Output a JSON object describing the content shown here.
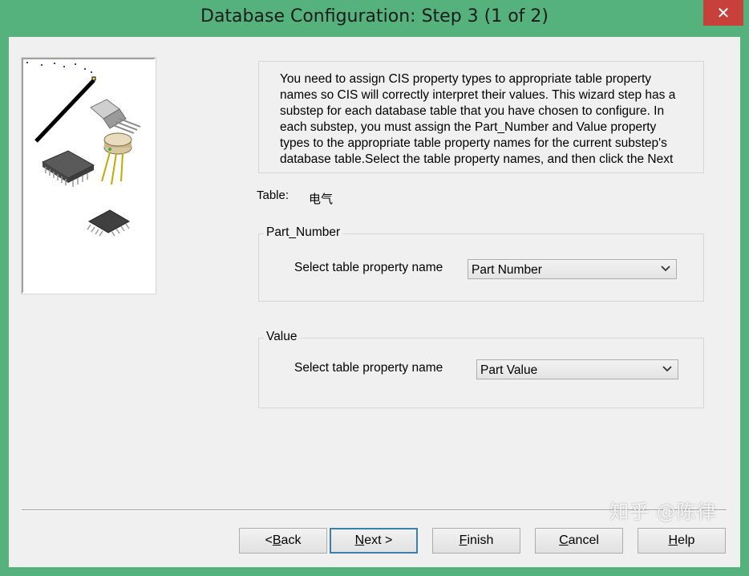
{
  "window": {
    "title": "Database Configuration: Step 3 (1 of 2)",
    "close_glyph": "✕"
  },
  "description": "You need to assign CIS property types to appropriate table property names so CIS will correctly interpret their values. This wizard step has a substep for each database table that you have chosen to configure. In each substep, you must assign the Part_Number and Value property types to the appropriate table property names for the current substep's database table.Select the table property names, and then click the Next",
  "table": {
    "label": "Table:",
    "value": "电气"
  },
  "part_number_group": {
    "legend": "Part_Number",
    "field_label": "Select table property name",
    "selected": "Part Number"
  },
  "value_group": {
    "legend": "Value",
    "field_label": "Select table property name",
    "selected": "Part Value"
  },
  "buttons": {
    "back": {
      "pre": "< ",
      "accel": "B",
      "post": "ack"
    },
    "next": {
      "pre": "",
      "accel": "N",
      "post": "ext >"
    },
    "finish": {
      "pre": "",
      "accel": "F",
      "post": "inish"
    },
    "cancel": {
      "pre": "",
      "accel": "C",
      "post": "ancel"
    },
    "help": {
      "pre": "",
      "accel": "H",
      "post": "elp"
    }
  },
  "watermark": "知乎 @陈律",
  "icons": {
    "close": "close-icon",
    "combo_arrow": "chevron-down-icon",
    "illustration": "electronic-components-illustration"
  },
  "colors": {
    "titlebar": "#55b27d",
    "close_button": "#c7403a",
    "dialog_background": "#f0f0f0",
    "default_button_border": "#3c7fb1"
  }
}
